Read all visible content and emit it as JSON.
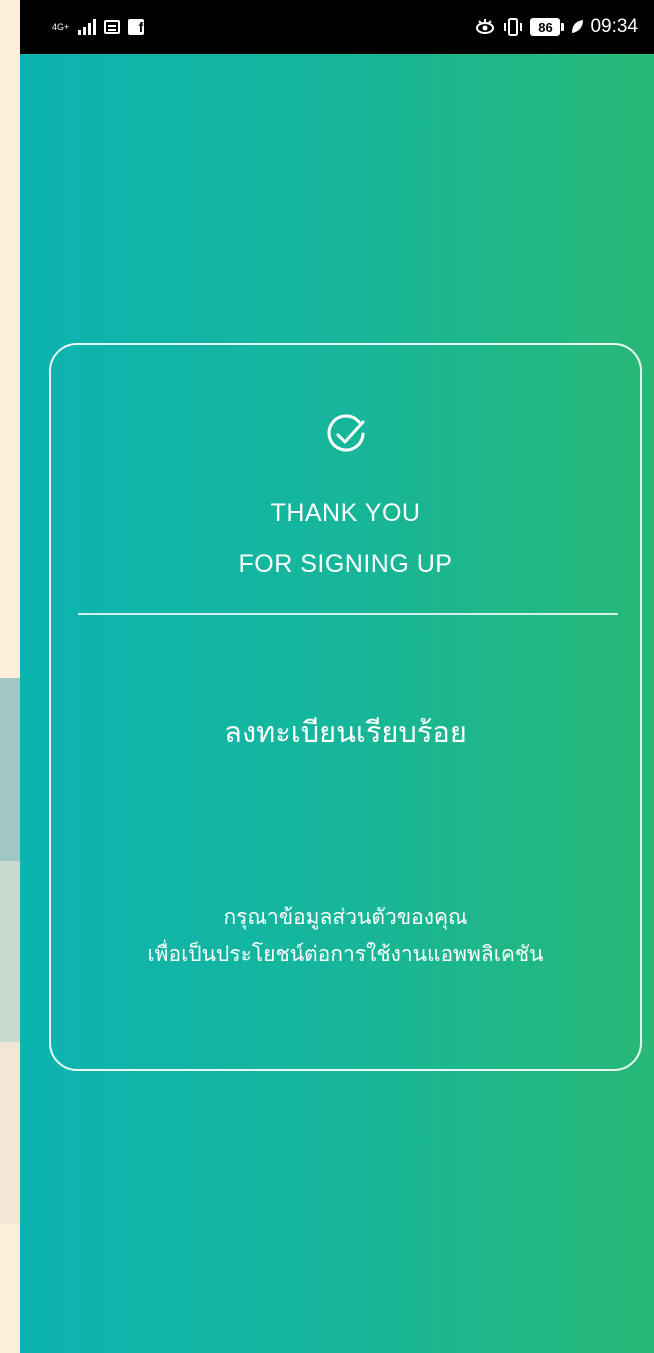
{
  "status_bar": {
    "network": "4G+",
    "battery": "86",
    "time": "09:34"
  },
  "card": {
    "title_line1": "THANK YOU",
    "title_line2": "FOR SIGNING UP",
    "subtitle": "ลงทะเบียนเรียบร้อย",
    "info_line1": "กรุณาข้อมูลส่วนตัวของคุณ",
    "info_line2": "เพื่อเป็นประโยชน์ต่อการใช้งานแอพพลิเคชัน"
  },
  "colors": {
    "gradient_start": "#0cb4b1",
    "gradient_end": "#28b876",
    "text": "#ffffff"
  }
}
